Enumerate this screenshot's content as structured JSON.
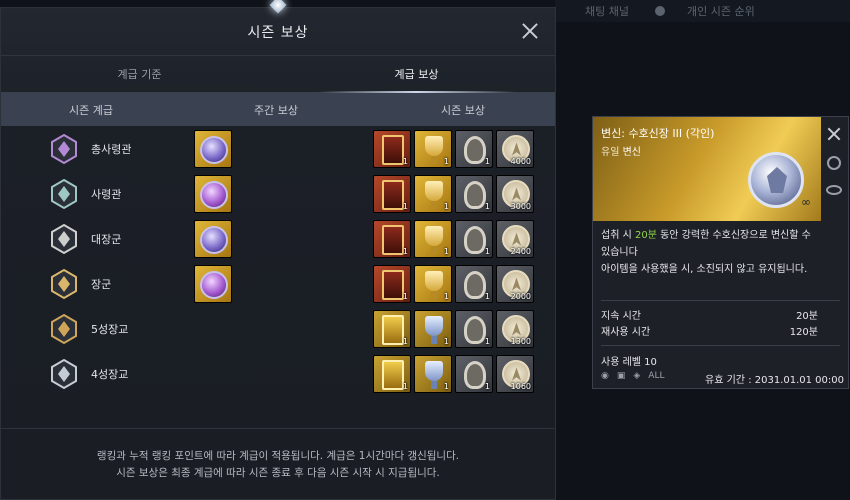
{
  "background": {
    "items": [
      "채팅 채널",
      "개인 시즌 순위"
    ]
  },
  "panel": {
    "title": "시즌 보상",
    "tabs": [
      {
        "label": "계급 기준",
        "active": false
      },
      {
        "label": "계급 보상",
        "active": true
      }
    ],
    "columns": [
      "시즌 계급",
      "주간 보상",
      "시즌 보상"
    ],
    "rows": [
      {
        "rank": "총사령관",
        "weekly": "orb",
        "rewards": [
          {
            "type": "card-red",
            "count": "1"
          },
          {
            "type": "trophy-gold",
            "count": "1"
          },
          {
            "type": "horn",
            "count": "1"
          },
          {
            "type": "coin",
            "count": "4000"
          }
        ]
      },
      {
        "rank": "사령관",
        "weekly": "orb-purple",
        "rewards": [
          {
            "type": "card-red",
            "count": "1"
          },
          {
            "type": "trophy-gold",
            "count": "1"
          },
          {
            "type": "horn",
            "count": "1"
          },
          {
            "type": "coin",
            "count": "3000"
          }
        ]
      },
      {
        "rank": "대장군",
        "weekly": "orb",
        "rewards": [
          {
            "type": "card-red",
            "count": "1"
          },
          {
            "type": "trophy-gold",
            "count": "1"
          },
          {
            "type": "horn",
            "count": "1"
          },
          {
            "type": "coin",
            "count": "2400"
          }
        ]
      },
      {
        "rank": "장군",
        "weekly": "orb-purple",
        "rewards": [
          {
            "type": "card-red",
            "count": "1"
          },
          {
            "type": "trophy-gold",
            "count": "1"
          },
          {
            "type": "horn",
            "count": "1"
          },
          {
            "type": "coin",
            "count": "2000"
          }
        ]
      },
      {
        "rank": "5성장교",
        "weekly": "",
        "rewards": [
          {
            "type": "card-gold",
            "count": "1"
          },
          {
            "type": "trophy-silver",
            "count": "1"
          },
          {
            "type": "horn",
            "count": "1"
          },
          {
            "type": "coin",
            "count": "1300"
          }
        ]
      },
      {
        "rank": "4성장교",
        "weekly": "",
        "rewards": [
          {
            "type": "card-gold",
            "count": "1"
          },
          {
            "type": "trophy-silver",
            "count": "1"
          },
          {
            "type": "horn",
            "count": "1"
          },
          {
            "type": "coin",
            "count": "1060"
          }
        ]
      }
    ],
    "footer": [
      "랭킹과 누적 랭킹 포인트에 따라 계급이 적용됩니다. 계급은 1시간마다 갱신됩니다.",
      "시즌 보상은 최종 계급에 따라 시즌 종료 후 다음 시즌 시작 시 지급됩니다."
    ]
  },
  "tooltip": {
    "title": "변신: 수호신장 III (각인)",
    "grade": "유일",
    "category": "변신",
    "infinity": "∞",
    "desc_parts": [
      "섭취 시 ",
      "20분",
      " 동안 강력한 수호신장으로 변신할 수 있습니다"
    ],
    "desc2": "아이템을 사용했을 시, 소진되지 않고 유지됩니다.",
    "stats": [
      {
        "label": "지속 시간",
        "value": "20분"
      },
      {
        "label": "재사용 시간",
        "value": "120분"
      }
    ],
    "level": "사용 레벨 10",
    "flags": [
      "ALL"
    ],
    "expire": "유효 기간 : 2031.01.01 00:00"
  },
  "colors": {
    "highlight": "#8fd54a",
    "banner": "#c99b2a"
  }
}
